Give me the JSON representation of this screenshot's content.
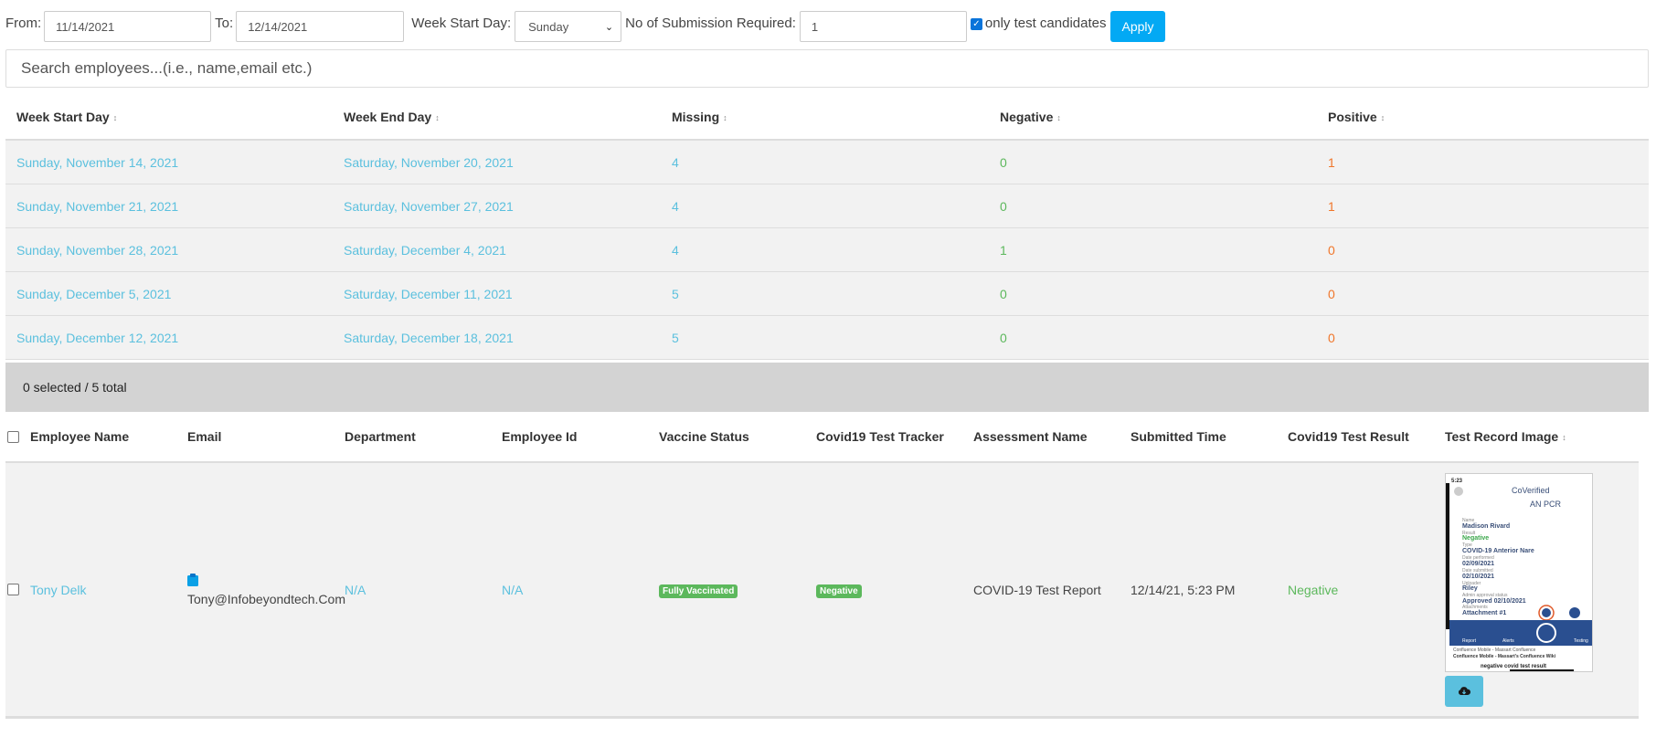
{
  "filters": {
    "from_label": "From:",
    "from_value": "11/14/2021",
    "to_label": "To:",
    "to_value": "12/14/2021",
    "week_start_label": "Week Start Day:",
    "week_start_value": "Sunday",
    "submissions_label": "No of Submission Required:",
    "submissions_value": "1",
    "only_test_label": "only test candidates",
    "only_test_checked": true,
    "apply_label": "Apply"
  },
  "search": {
    "placeholder": "Search employees...(i.e., name,email etc.)"
  },
  "week_table": {
    "headers": [
      "Week Start Day",
      "Week End Day",
      "Missing",
      "Negative",
      "Positive"
    ],
    "rows": [
      {
        "start": "Sunday, November 14, 2021",
        "end": "Saturday, November 20, 2021",
        "missing": "4",
        "negative": "0",
        "positive": "1"
      },
      {
        "start": "Sunday, November 21, 2021",
        "end": "Saturday, November 27, 2021",
        "missing": "4",
        "negative": "0",
        "positive": "1"
      },
      {
        "start": "Sunday, November 28, 2021",
        "end": "Saturday, December 4, 2021",
        "missing": "4",
        "negative": "1",
        "positive": "0"
      },
      {
        "start": "Sunday, December 5, 2021",
        "end": "Saturday, December 11, 2021",
        "missing": "5",
        "negative": "0",
        "positive": "0"
      },
      {
        "start": "Sunday, December 12, 2021",
        "end": "Saturday, December 18, 2021",
        "missing": "5",
        "negative": "0",
        "positive": "0"
      }
    ]
  },
  "selection": {
    "summary": "0 selected / 5 total"
  },
  "employee_table": {
    "headers": [
      "Employee Name",
      "Email",
      "Department",
      "Employee Id",
      "Vaccine Status",
      "Covid19 Test Tracker",
      "Assessment Name",
      "Submitted Time",
      "Covid19 Test Result",
      "Test Record Image"
    ],
    "rows": [
      {
        "name": "Tony Delk",
        "email": "Tony@Infobeyondtech.Com",
        "department": "N/A",
        "employee_id": "N/A",
        "vaccine_status": "Fully Vaccinated",
        "test_tracker": "Negative",
        "assessment": "COVID-19 Test Report",
        "submitted": "12/14/21, 5:23 PM",
        "result": "Negative"
      }
    ]
  },
  "thumbnail": {
    "time": "5:23",
    "brand": "CoVerified",
    "title": "AN PCR",
    "name_label": "Name",
    "name_value": "Madison Rivard",
    "result_label": "Result",
    "result_value": "Negative",
    "type_label": "Type",
    "type_value": "COVID-19 Anterior Nare",
    "date_label": "Date performed",
    "date_value": "02/09/2021",
    "submitted_label": "Date submitted",
    "submitted_value": "02/10/2021",
    "uploader_label": "Uploader",
    "uploader_value": "Riley",
    "status_label": "Admin approval status",
    "status_value": "Approved 02/10/2021",
    "attach_label": "Attachments",
    "attach_value": "Attachment #1",
    "nav": [
      "Report",
      "Alerts",
      "",
      "Testing"
    ],
    "footer1": "Confluence Mobile - Massart Confluence",
    "footer2": "Confluence Mobile - Massart's Confluence Wiki",
    "footer3": "negative covid test result"
  },
  "colors": {
    "link": "#5bc0de",
    "negative": "#5cb85c",
    "positive": "#f0762a",
    "apply": "#03a9f4"
  }
}
